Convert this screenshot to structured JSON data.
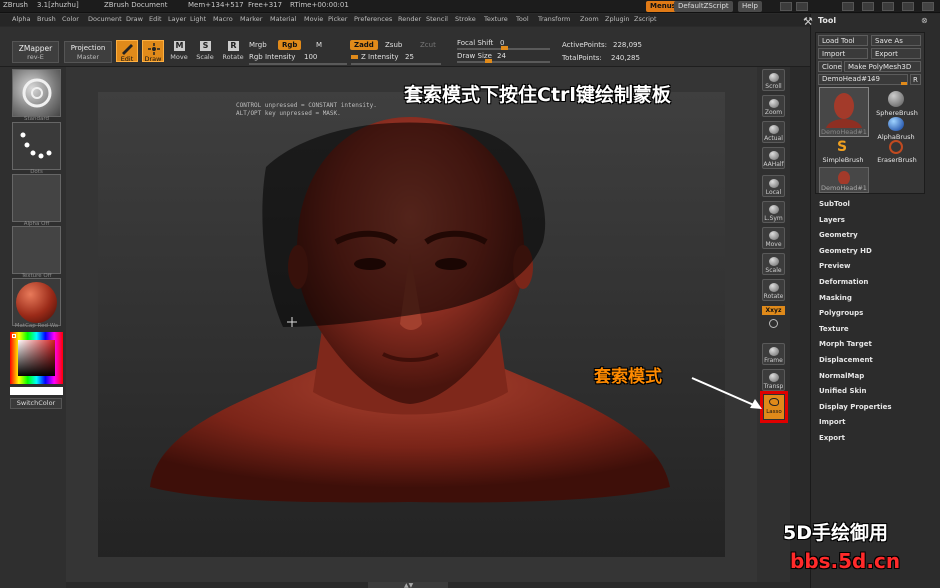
{
  "titlebar": {
    "app": "ZBrush",
    "version": "3.1[zhuzhu]",
    "document": "ZBrush Document",
    "mem": "Mem+134+517",
    "free": "Free+317",
    "rtime": "RTime+00:00:01",
    "menus_btn": "Menus",
    "script_btn": "DefaultZScript",
    "help_btn": "Help"
  },
  "menubar": {
    "items": [
      "Alpha",
      "Brush",
      "Color",
      "Document",
      "Draw",
      "Edit",
      "Layer",
      "Light",
      "Macro",
      "Marker",
      "Material",
      "Movie",
      "Picker",
      "Preferences",
      "Render",
      "Stencil",
      "Stroke",
      "Texture",
      "Tool",
      "Transform",
      "Zoom",
      "Zplugin",
      "Zscript"
    ]
  },
  "toolbar": {
    "zmapper_label": "ZMapper",
    "zmapper_sub": "rev-E",
    "projection_label": "Projection",
    "projection_sub": "Master",
    "edit_label": "Edit",
    "draw_label": "Draw",
    "move_label": "Move",
    "scale_label": "Scale",
    "rotate_label": "Rotate",
    "mrgb_label": "Mrgb",
    "rgb_label": "Rgb",
    "m_label": "M",
    "rgb_intensity_label": "Rgb Intensity",
    "rgb_intensity_value": "100",
    "zadd_label": "Zadd",
    "zsub_label": "Zsub",
    "zcut_label": "Zcut",
    "z_intensity_label": "Z Intensity",
    "z_intensity_value": "25",
    "focal_shift_label": "Focal Shift",
    "focal_shift_value": "0",
    "draw_size_label": "Draw Size",
    "draw_size_value": "24",
    "active_points_label": "ActivePoints:",
    "active_points_value": "228,095",
    "total_points_label": "TotalPoints:",
    "total_points_value": "240,285"
  },
  "leftshelf": {
    "standard_label": "Standard",
    "dots_label": "Dots",
    "alpha_label": "Alpha  Off",
    "texture_label": "Texture  Off",
    "matcap_label": "MatCap  Red  Wa",
    "switchcolor_label": "SwitchColor"
  },
  "canvas": {
    "hint_line1": "CONTROL unpressed = CONSTANT intensity.",
    "hint_line2": "ALT/OPT key unpressed = MASK."
  },
  "rightshelf": {
    "scroll": "Scroll",
    "zoom": "Zoom",
    "actual": "Actual",
    "aahalf": "AAHalf",
    "local": "Local",
    "lsym": "L.Sym",
    "move": "Move",
    "scale": "Scale",
    "rotate": "Rotate",
    "xyz": "Xxyz",
    "frame": "Frame",
    "transp": "Transp",
    "lasso": "Lasso"
  },
  "toolpanel": {
    "title": "Tool",
    "load_tool": "Load Tool",
    "save_as": "Save As",
    "import": "Import",
    "export": "Export",
    "clone": "Clone",
    "make_polymesh": "Make PolyMesh3D",
    "current_tool": "DemoHead#1.",
    "current_tool_value": "49",
    "r_btn": "R",
    "brushes": [
      "DemoHead#1",
      "SphereBrush",
      "AlphaBrush",
      "SimpleBrush",
      "EraserBrush",
      "DemoHead#1"
    ],
    "sections": [
      "SubTool",
      "Layers",
      "Geometry",
      "Geometry HD",
      "Preview",
      "Deformation",
      "Masking",
      "Polygroups",
      "Texture",
      "Morph Target",
      "Displacement",
      "NormalMap",
      "Unified Skin",
      "Display Properties",
      "Import",
      "Export"
    ]
  },
  "annotations": {
    "headline": "套索模式下按住Ctrl键绘制蒙板",
    "lasso_mode": "套索模式",
    "watermark_1": "5D手绘御用",
    "watermark_2": "bbs.5d.cn"
  },
  "colors": {
    "accent": "#e08a1a",
    "headline_text": "#ffffff",
    "lasso_text": "#ff8a00",
    "lasso_box": "#e00000",
    "watermark_text": "#ffffff",
    "watermark_url": "#ff2a2a",
    "model_skin": "#8e2f22"
  }
}
